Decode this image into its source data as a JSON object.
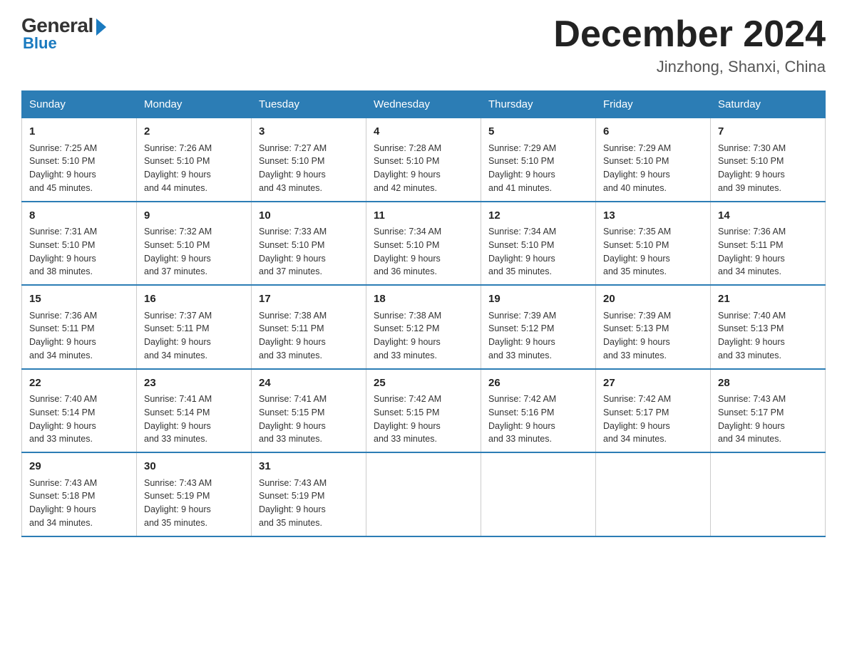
{
  "logo": {
    "general": "General",
    "blue": "Blue"
  },
  "title": {
    "month_year": "December 2024",
    "location": "Jinzhong, Shanxi, China"
  },
  "headers": [
    "Sunday",
    "Monday",
    "Tuesday",
    "Wednesday",
    "Thursday",
    "Friday",
    "Saturday"
  ],
  "weeks": [
    [
      {
        "day": "1",
        "sunrise": "7:25 AM",
        "sunset": "5:10 PM",
        "daylight": "9 hours and 45 minutes."
      },
      {
        "day": "2",
        "sunrise": "7:26 AM",
        "sunset": "5:10 PM",
        "daylight": "9 hours and 44 minutes."
      },
      {
        "day": "3",
        "sunrise": "7:27 AM",
        "sunset": "5:10 PM",
        "daylight": "9 hours and 43 minutes."
      },
      {
        "day": "4",
        "sunrise": "7:28 AM",
        "sunset": "5:10 PM",
        "daylight": "9 hours and 42 minutes."
      },
      {
        "day": "5",
        "sunrise": "7:29 AM",
        "sunset": "5:10 PM",
        "daylight": "9 hours and 41 minutes."
      },
      {
        "day": "6",
        "sunrise": "7:29 AM",
        "sunset": "5:10 PM",
        "daylight": "9 hours and 40 minutes."
      },
      {
        "day": "7",
        "sunrise": "7:30 AM",
        "sunset": "5:10 PM",
        "daylight": "9 hours and 39 minutes."
      }
    ],
    [
      {
        "day": "8",
        "sunrise": "7:31 AM",
        "sunset": "5:10 PM",
        "daylight": "9 hours and 38 minutes."
      },
      {
        "day": "9",
        "sunrise": "7:32 AM",
        "sunset": "5:10 PM",
        "daylight": "9 hours and 37 minutes."
      },
      {
        "day": "10",
        "sunrise": "7:33 AM",
        "sunset": "5:10 PM",
        "daylight": "9 hours and 37 minutes."
      },
      {
        "day": "11",
        "sunrise": "7:34 AM",
        "sunset": "5:10 PM",
        "daylight": "9 hours and 36 minutes."
      },
      {
        "day": "12",
        "sunrise": "7:34 AM",
        "sunset": "5:10 PM",
        "daylight": "9 hours and 35 minutes."
      },
      {
        "day": "13",
        "sunrise": "7:35 AM",
        "sunset": "5:10 PM",
        "daylight": "9 hours and 35 minutes."
      },
      {
        "day": "14",
        "sunrise": "7:36 AM",
        "sunset": "5:11 PM",
        "daylight": "9 hours and 34 minutes."
      }
    ],
    [
      {
        "day": "15",
        "sunrise": "7:36 AM",
        "sunset": "5:11 PM",
        "daylight": "9 hours and 34 minutes."
      },
      {
        "day": "16",
        "sunrise": "7:37 AM",
        "sunset": "5:11 PM",
        "daylight": "9 hours and 34 minutes."
      },
      {
        "day": "17",
        "sunrise": "7:38 AM",
        "sunset": "5:11 PM",
        "daylight": "9 hours and 33 minutes."
      },
      {
        "day": "18",
        "sunrise": "7:38 AM",
        "sunset": "5:12 PM",
        "daylight": "9 hours and 33 minutes."
      },
      {
        "day": "19",
        "sunrise": "7:39 AM",
        "sunset": "5:12 PM",
        "daylight": "9 hours and 33 minutes."
      },
      {
        "day": "20",
        "sunrise": "7:39 AM",
        "sunset": "5:13 PM",
        "daylight": "9 hours and 33 minutes."
      },
      {
        "day": "21",
        "sunrise": "7:40 AM",
        "sunset": "5:13 PM",
        "daylight": "9 hours and 33 minutes."
      }
    ],
    [
      {
        "day": "22",
        "sunrise": "7:40 AM",
        "sunset": "5:14 PM",
        "daylight": "9 hours and 33 minutes."
      },
      {
        "day": "23",
        "sunrise": "7:41 AM",
        "sunset": "5:14 PM",
        "daylight": "9 hours and 33 minutes."
      },
      {
        "day": "24",
        "sunrise": "7:41 AM",
        "sunset": "5:15 PM",
        "daylight": "9 hours and 33 minutes."
      },
      {
        "day": "25",
        "sunrise": "7:42 AM",
        "sunset": "5:15 PM",
        "daylight": "9 hours and 33 minutes."
      },
      {
        "day": "26",
        "sunrise": "7:42 AM",
        "sunset": "5:16 PM",
        "daylight": "9 hours and 33 minutes."
      },
      {
        "day": "27",
        "sunrise": "7:42 AM",
        "sunset": "5:17 PM",
        "daylight": "9 hours and 34 minutes."
      },
      {
        "day": "28",
        "sunrise": "7:43 AM",
        "sunset": "5:17 PM",
        "daylight": "9 hours and 34 minutes."
      }
    ],
    [
      {
        "day": "29",
        "sunrise": "7:43 AM",
        "sunset": "5:18 PM",
        "daylight": "9 hours and 34 minutes."
      },
      {
        "day": "30",
        "sunrise": "7:43 AM",
        "sunset": "5:19 PM",
        "daylight": "9 hours and 35 minutes."
      },
      {
        "day": "31",
        "sunrise": "7:43 AM",
        "sunset": "5:19 PM",
        "daylight": "9 hours and 35 minutes."
      },
      null,
      null,
      null,
      null
    ]
  ],
  "labels": {
    "sunrise": "Sunrise:",
    "sunset": "Sunset:",
    "daylight": "Daylight:"
  }
}
